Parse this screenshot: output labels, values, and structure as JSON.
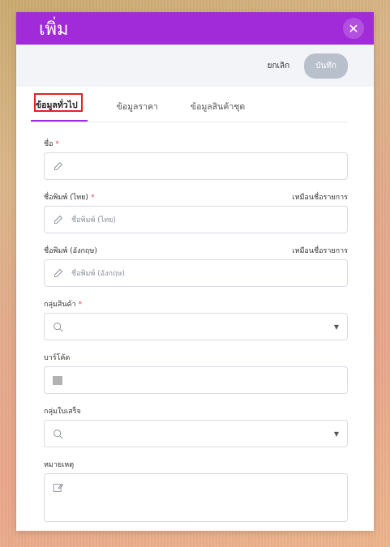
{
  "modal": {
    "title": "เพิ่ม",
    "close_icon": "close-icon",
    "accent_color": "#a12bd9"
  },
  "actions": {
    "cancel_label": "ยกเลิก",
    "save_label": "บันทึก"
  },
  "tabs": [
    {
      "label": "ข้อมูลทั่วไป",
      "active": true
    },
    {
      "label": "ข้อมูลราคา",
      "active": false
    },
    {
      "label": "ข้อมูลสินค้าชุด",
      "active": false
    }
  ],
  "fields": {
    "name": {
      "label": "ชื่อ",
      "required": "*",
      "placeholder": "",
      "icon": "pencil-icon"
    },
    "print_name_th": {
      "label": "ชื่อพิมพ์ (ไทย)",
      "required": "*",
      "right_label": "เหมือนชื่อรายการ",
      "placeholder": "ชื่อพิมพ์ (ไทย)",
      "icon": "pencil-icon"
    },
    "print_name_en": {
      "label": "ชื่อพิมพ์ (อังกฤษ)",
      "right_label": "เหมือนชื่อรายการ",
      "placeholder": "ชื่อพิมพ์ (อังกฤษ)",
      "icon": "pencil-icon"
    },
    "product_group": {
      "label": "กลุ่มสินค้า",
      "required": "*",
      "icon": "search-icon"
    },
    "barcode": {
      "label": "บาร์โค้ด",
      "icon": "barcode-icon"
    },
    "receipt_group": {
      "label": "กลุ่มใบเสร็จ",
      "icon": "search-icon"
    },
    "note": {
      "label": "หมายเหตุ",
      "icon": "edit-icon"
    }
  }
}
